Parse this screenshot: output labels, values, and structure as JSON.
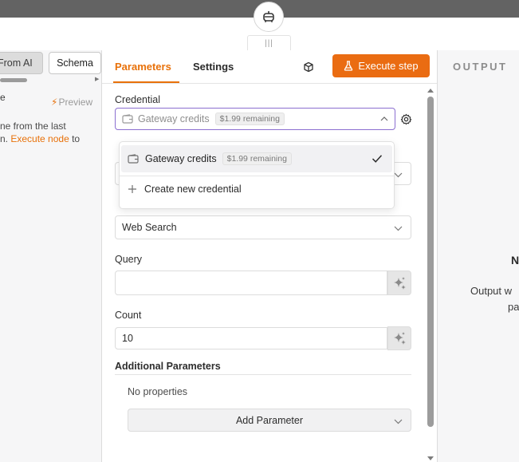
{
  "left_panel": {
    "tab_from_ai": "From AI",
    "tab_schema": "Schema",
    "truncated_title": "e",
    "preview_label": "Preview",
    "text_line1": "ne from the last",
    "text_line2_prefix": "n.",
    "execute_node_link": "Execute node",
    "text_line2_suffix": "to"
  },
  "center": {
    "tabs": {
      "parameters": "Parameters",
      "settings": "Settings"
    },
    "execute_button": "Execute step",
    "credential": {
      "label": "Credential",
      "value": "Gateway credits",
      "badge": "$1.99 remaining"
    },
    "dropdown": {
      "option_selected": {
        "label": "Gateway credits",
        "badge": "$1.99 remaining"
      },
      "option_create": "Create new credential"
    },
    "operation_value": "Web Search",
    "query": {
      "label": "Query",
      "value": ""
    },
    "count": {
      "label": "Count",
      "value": "10"
    },
    "additional_parameters": {
      "label": "Additional Parameters",
      "empty_text": "No properties",
      "add_button": "Add Parameter"
    }
  },
  "right_panel": {
    "title": "OUTPUT",
    "heading_fragment": "N",
    "text_line1": "Output w",
    "text_line2": "pa"
  },
  "colors": {
    "accent": "#e8710a",
    "execute_button": "#ea6c12",
    "focus_border": "#8b6fd0"
  }
}
